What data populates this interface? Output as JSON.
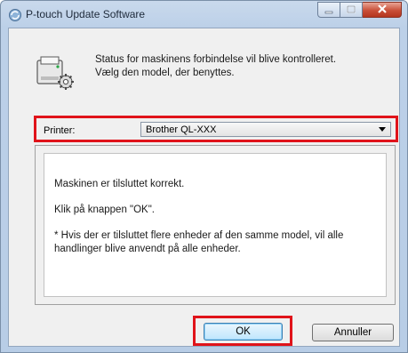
{
  "window": {
    "title": "P-touch Update Software",
    "buttons": {
      "minimize_icon": "minimize-icon",
      "maximize_icon": "maximize-icon",
      "close_icon": "close-icon"
    }
  },
  "header": {
    "icon": "printer-settings-icon",
    "status_line1": "Status for maskinens forbindelse vil blive kontrolleret.",
    "status_line2": "Vælg den model, der benyttes."
  },
  "printer": {
    "label": "Printer:",
    "selected": "Brother QL-XXX"
  },
  "messages": {
    "line1": "Maskinen er tilsluttet korrekt.",
    "line2": "Klik på knappen \"OK\".",
    "line3a": "* Hvis der er tilsluttet flere enheder af den samme model, vil alle",
    "line3b": "handlinger blive anvendt på alle enheder."
  },
  "footer": {
    "ok_label": "OK",
    "cancel_label": "Annuller"
  },
  "colors": {
    "highlight": "#e0131a",
    "title_bar": "#bcd0e8",
    "close_button": "#c94f38"
  }
}
